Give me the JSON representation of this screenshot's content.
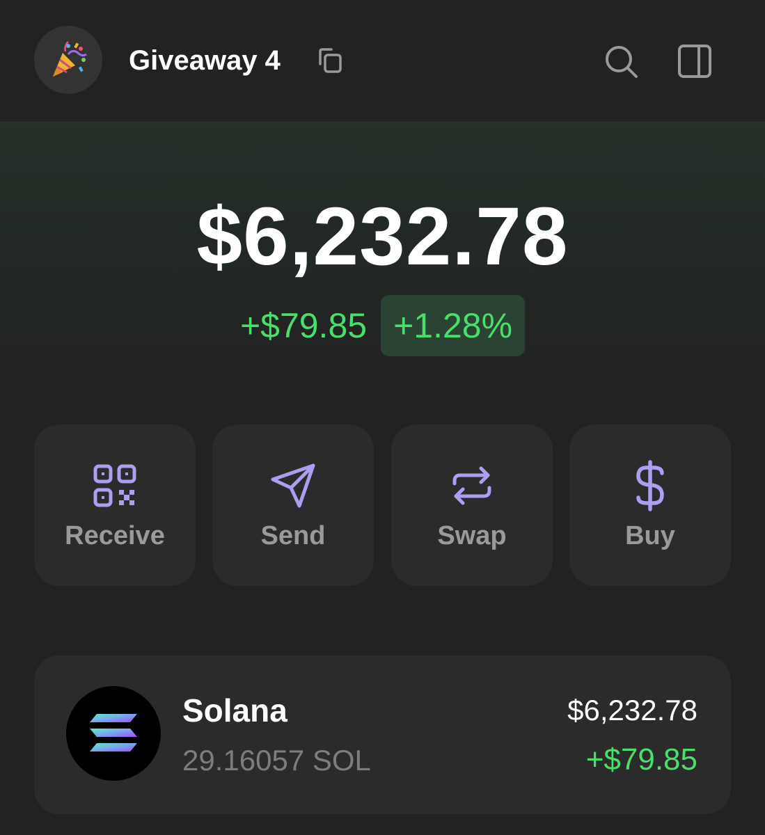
{
  "header": {
    "wallet_name": "Giveaway 4",
    "avatar_icon": "party-popper-icon",
    "copy_icon": "copy-icon",
    "search_icon": "search-icon",
    "panel_icon": "sidebar-panel-icon"
  },
  "balance": {
    "total": "$6,232.78",
    "change_amount": "+$79.85",
    "change_percent": "+1.28%"
  },
  "actions": [
    {
      "label": "Receive",
      "icon": "qr-code-icon"
    },
    {
      "label": "Send",
      "icon": "send-icon"
    },
    {
      "label": "Swap",
      "icon": "swap-icon"
    },
    {
      "label": "Buy",
      "icon": "dollar-icon"
    }
  ],
  "tokens": [
    {
      "name": "Solana",
      "amount": "29.16057 SOL",
      "value": "$6,232.78",
      "change": "+$79.85",
      "icon": "solana-logo-icon"
    }
  ],
  "colors": {
    "background": "#222222",
    "card": "#2b2b2b",
    "accent_purple": "#ab9ff2",
    "positive_green": "#4ade6b",
    "muted_text": "#9a9a9a"
  }
}
